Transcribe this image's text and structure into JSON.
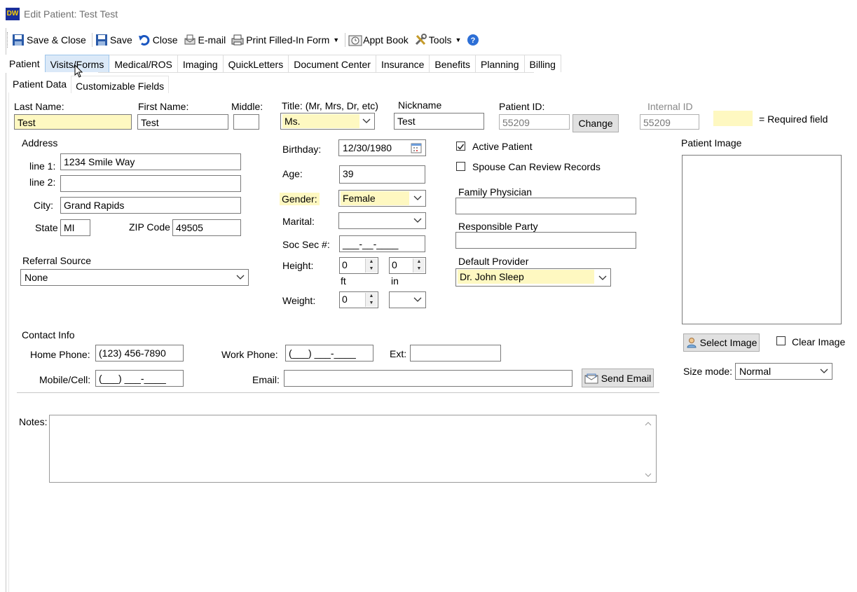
{
  "window": {
    "title": "Edit Patient: Test Test",
    "logo": "DW"
  },
  "toolbar": {
    "save_close": "Save & Close",
    "save": "Save",
    "close": "Close",
    "email": "E-mail",
    "print": "Print Filled-In Form",
    "appt_book": "Appt Book",
    "tools": "Tools"
  },
  "tabs": [
    "Patient",
    "Visits/Forms",
    "Medical/ROS",
    "Imaging",
    "QuickLetters",
    "Document Center",
    "Insurance",
    "Benefits",
    "Planning",
    "Billing"
  ],
  "subtabs": [
    "Patient Data",
    "Customizable Fields"
  ],
  "labels": {
    "last_name": "Last Name:",
    "first_name": "First Name:",
    "middle": "Middle:",
    "title": "Title: (Mr, Mrs, Dr, etc)",
    "nickname": "Nickname",
    "patient_id": "Patient ID:",
    "internal_id": "Internal ID",
    "required_field": "= Required field",
    "address": "Address",
    "line1": "line 1:",
    "line2": "line 2:",
    "city": "City:",
    "state": "State",
    "zip": "ZIP Code",
    "referral_source": "Referral Source",
    "birthday": "Birthday:",
    "age": "Age:",
    "gender": "Gender:",
    "marital": "Marital:",
    "ssn": "Soc Sec #:",
    "height": "Height:",
    "ft": "ft",
    "in": "in",
    "weight": "Weight:",
    "active_patient": "Active Patient",
    "spouse_review": "Spouse Can Review Records",
    "family_physician": "Family Physician",
    "responsible_party": "Responsible Party",
    "default_provider": "Default Provider",
    "patient_image": "Patient Image",
    "contact_info": "Contact Info",
    "home_phone": "Home Phone:",
    "work_phone": "Work Phone:",
    "ext": "Ext:",
    "mobile": "Mobile/Cell:",
    "email": "Email:",
    "notes": "Notes:",
    "size_mode": "Size mode:",
    "clear_image": "Clear Image"
  },
  "values": {
    "last_name": "Test",
    "first_name": "Test",
    "middle": "",
    "title": "Ms.",
    "nickname": "Test",
    "patient_id": "55209",
    "internal_id": "55209",
    "line1": "1234 Smile Way",
    "line2": "",
    "city": "Grand Rapids",
    "state": "MI",
    "zip": "49505",
    "referral_source": "None",
    "birthday": "12/30/1980",
    "age": "39",
    "gender": "Female",
    "marital": "",
    "ssn": "___-__-____",
    "height_ft": "0",
    "height_in": "0",
    "weight": "0",
    "weight_unit": "",
    "family_physician": "",
    "responsible_party": "",
    "default_provider": "Dr. John Sleep",
    "home_phone": "(123) 456-7890",
    "work_phone": "(___) ___-____",
    "ext": "",
    "mobile": "(___) ___-____",
    "email": "",
    "notes": "",
    "size_mode": "Normal",
    "active_patient": true,
    "spouse_review": false,
    "clear_image": false
  },
  "buttons": {
    "change": "Change",
    "send_email": "Send Email",
    "select_image": "Select Image"
  },
  "colors": {
    "required": "#fef8c1",
    "tab_hover": "#dbe9f8"
  }
}
